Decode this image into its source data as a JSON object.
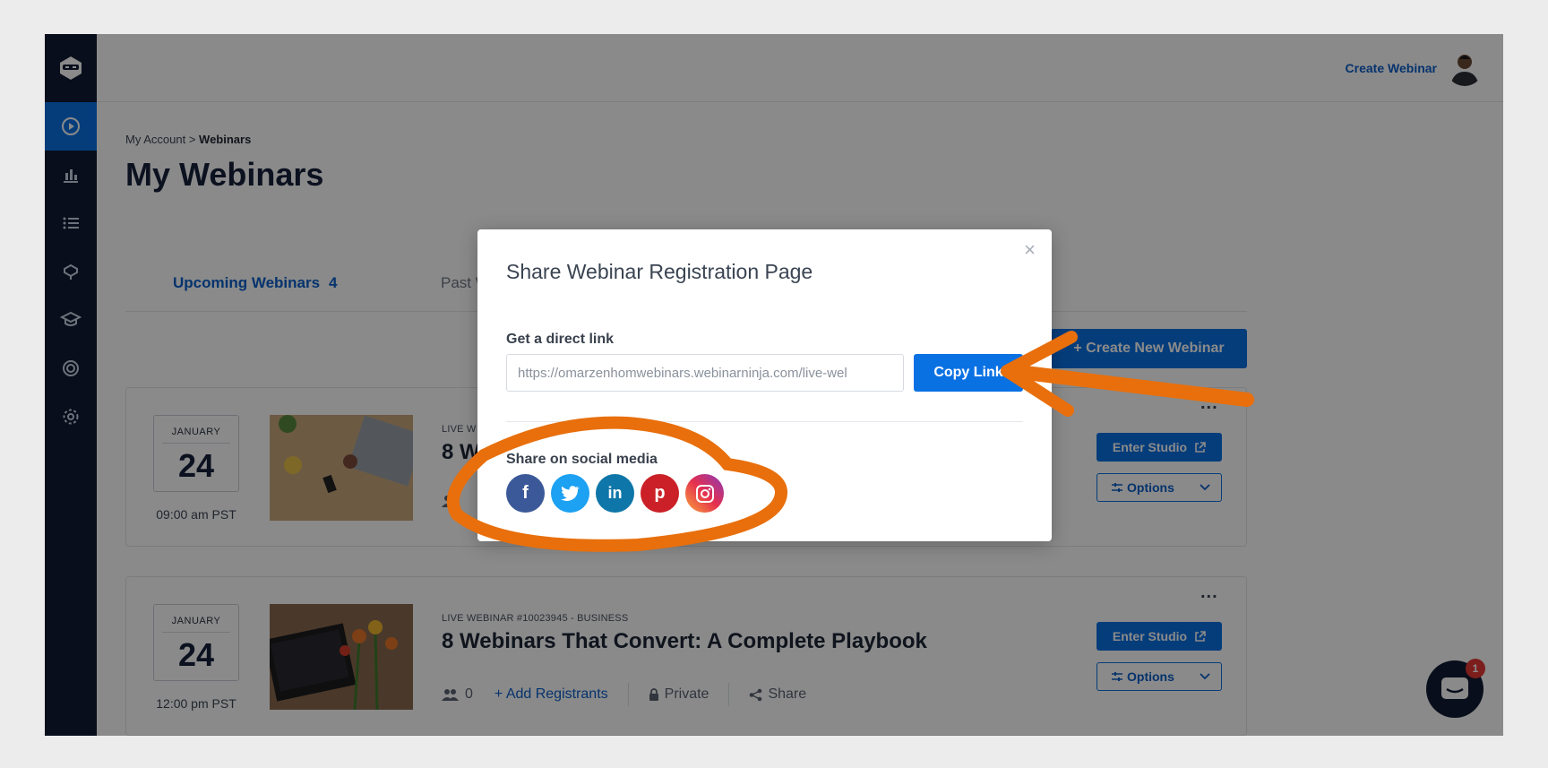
{
  "header": {
    "create_webinar_link": "Create Webinar"
  },
  "breadcrumb": {
    "parent": "My Account",
    "separator": " > ",
    "current": "Webinars"
  },
  "page_title": "My Webinars",
  "tabs": [
    {
      "label": "Upcoming Webinars",
      "count": "4"
    },
    {
      "label": "Past W"
    }
  ],
  "create_new_button": "+ Create New Webinar",
  "webinars": [
    {
      "month": "JANUARY",
      "day": "24",
      "time": "09:00 am PST",
      "meta": "LIVE W",
      "title": "8 W",
      "enter_studio": "Enter Studio",
      "options": "Options"
    },
    {
      "month": "JANUARY",
      "day": "24",
      "time": "12:00 pm PST",
      "meta": "LIVE WEBINAR #10023945 - BUSINESS",
      "title": "8 Webinars That Convert: A Complete Playbook",
      "registrants": "0",
      "add_registrants": "+ Add Registrants",
      "privacy": "Private",
      "share": "Share",
      "enter_studio": "Enter Studio",
      "options": "Options"
    }
  ],
  "more_menu": "...",
  "chat": {
    "badge": "1"
  },
  "modal": {
    "title": "Share Webinar Registration Page",
    "close": "×",
    "direct_link_label": "Get a direct link",
    "link_value": "https://omarzenhomwebinars.webinarninja.com/live-wel",
    "copy_button": "Copy Link",
    "social_label": "Share on social media",
    "socials": [
      {
        "name": "facebook",
        "glyph": "f"
      },
      {
        "name": "twitter",
        "glyph": "t"
      },
      {
        "name": "linkedin",
        "glyph": "in"
      },
      {
        "name": "pinterest",
        "glyph": "p"
      },
      {
        "name": "instagram",
        "glyph": ""
      }
    ]
  },
  "colors": {
    "sidebar": "#0f1b32",
    "primary": "#0a71e3",
    "annotation": "#e86f0c"
  }
}
